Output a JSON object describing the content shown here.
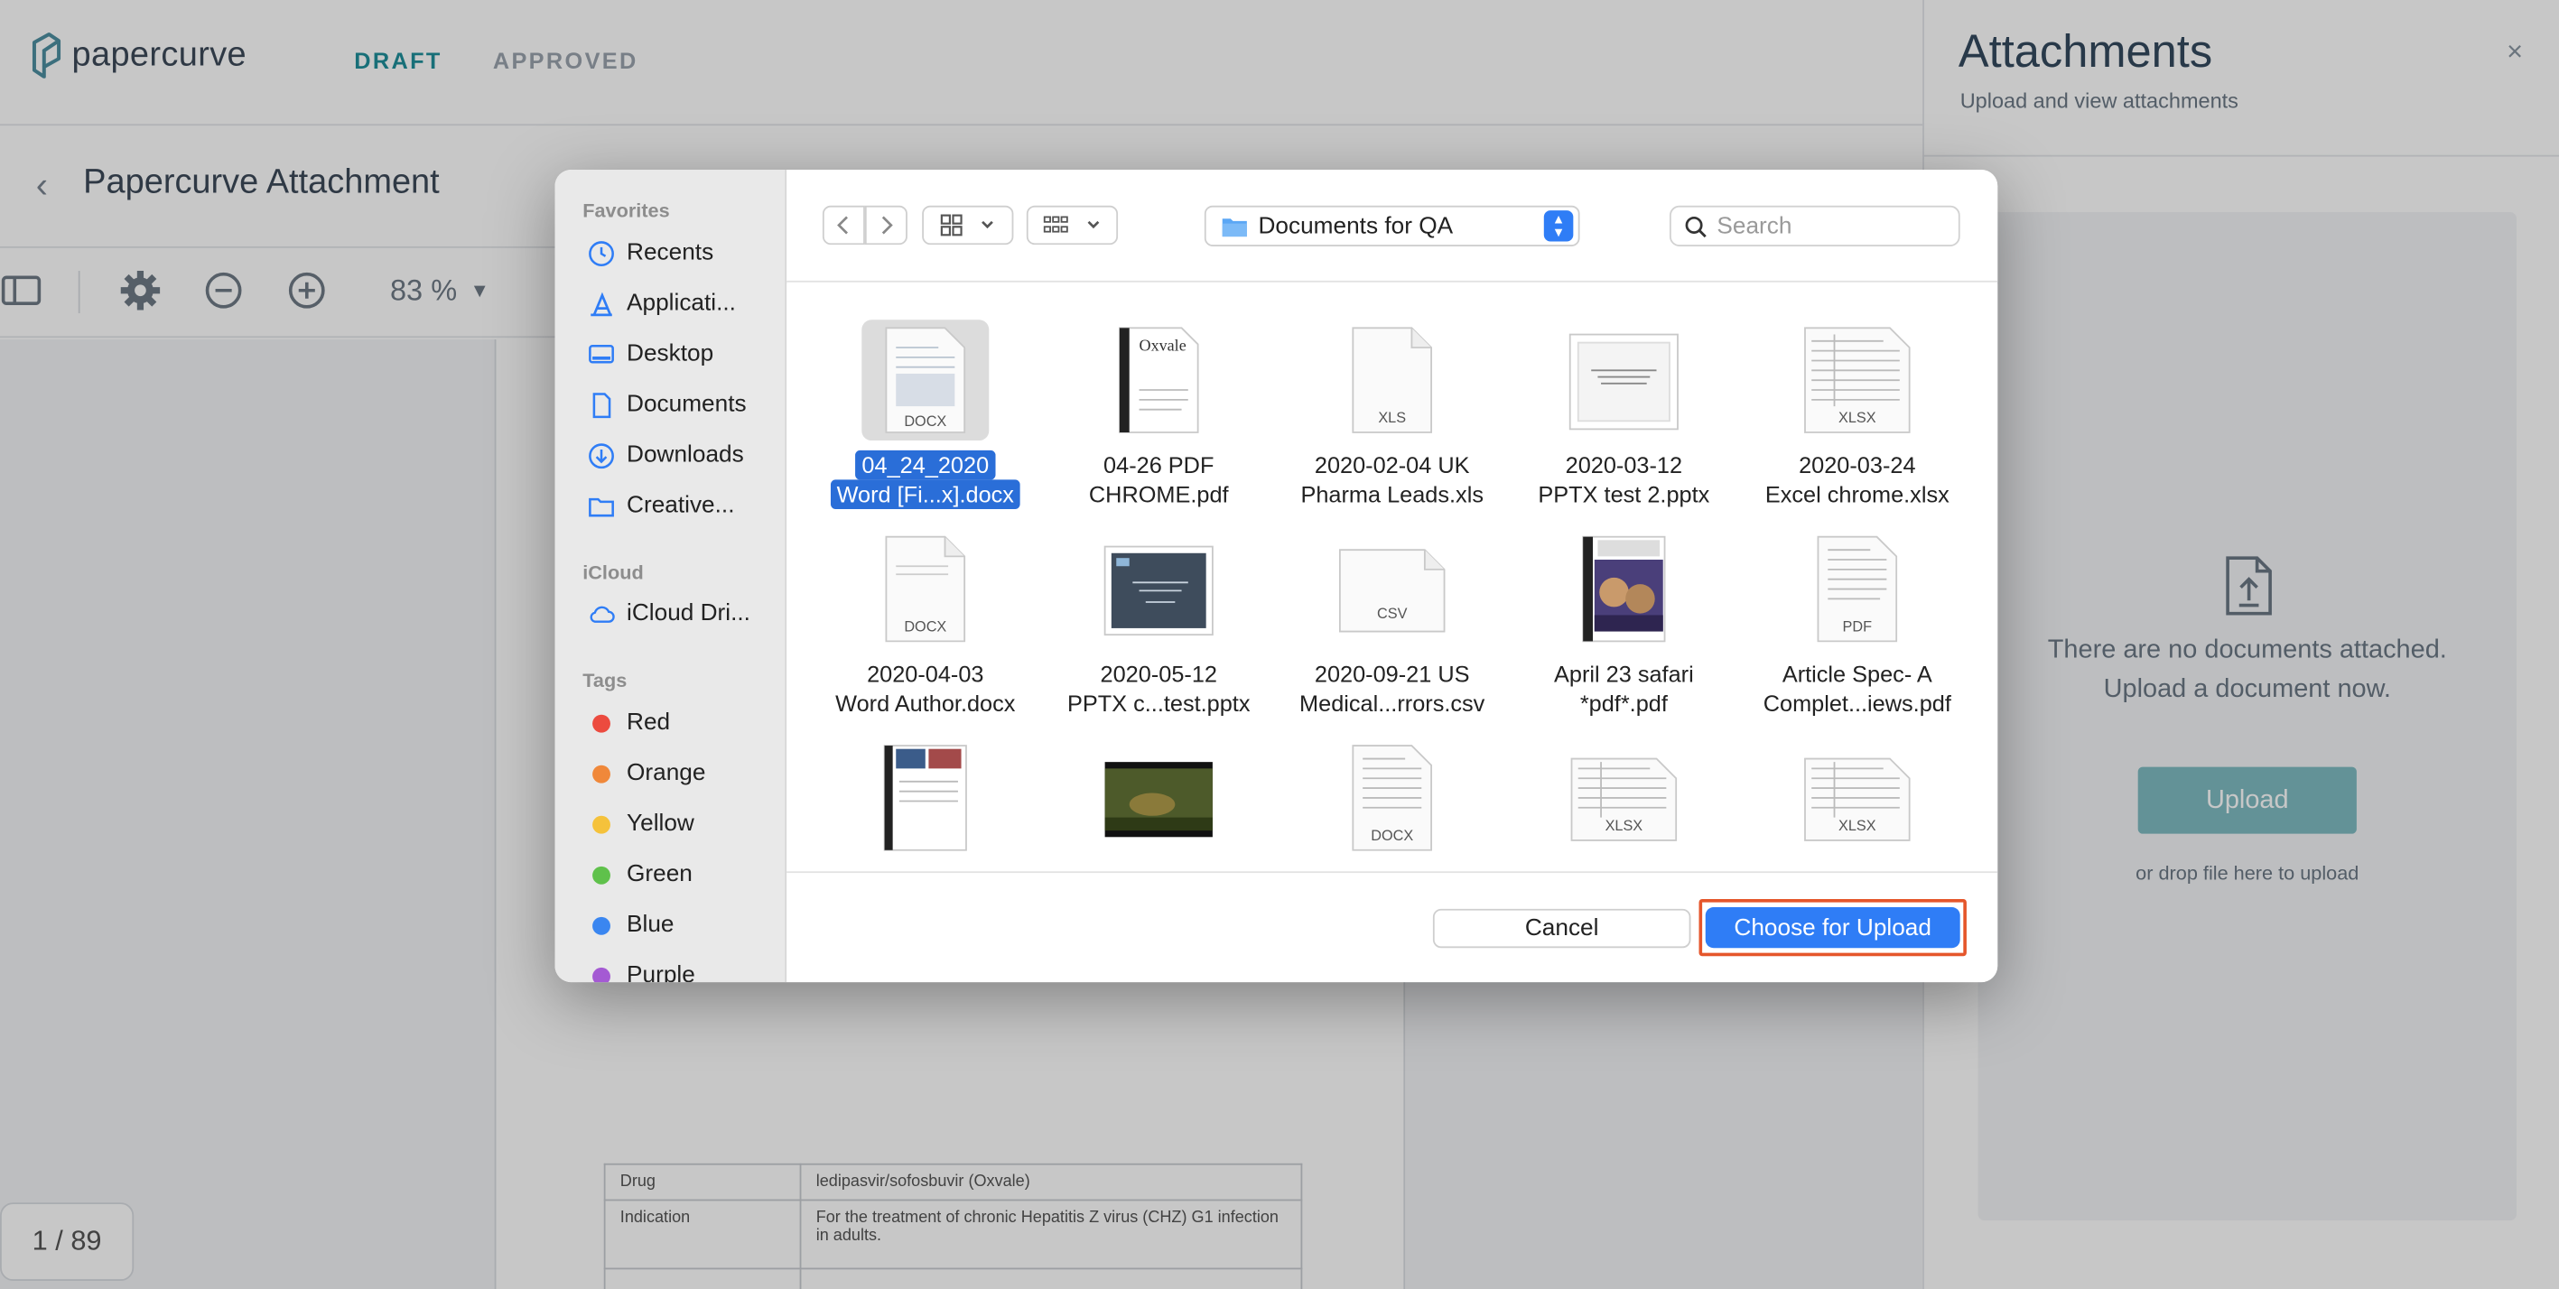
{
  "app": {
    "logo_text": "papercurve",
    "tabs": [
      "DRAFT",
      "APPROVED"
    ],
    "doc_title": "Papercurve Attachment",
    "zoom": "83 %",
    "page_counter": "1 / 89"
  },
  "document_table": [
    {
      "label": "Drug",
      "value": "ledipasvir/sofosbuvir (Oxvale)"
    },
    {
      "label": "Indication",
      "value": "For the treatment of chronic Hepatitis Z virus (CHZ) G1 infection in adults."
    }
  ],
  "attachments": {
    "title": "Attachments",
    "subtitle": "Upload and view attachments",
    "close": "×",
    "empty_line1": "There are no documents attached.",
    "empty_line2": "Upload a document now.",
    "upload_label": "Upload",
    "drop_hint": "or drop file here to upload"
  },
  "dialog": {
    "favorites_heading": "Favorites",
    "favorites": [
      {
        "label": "Recents",
        "icon": "clock-icon"
      },
      {
        "label": "Applicati...",
        "icon": "applications-icon"
      },
      {
        "label": "Desktop",
        "icon": "desktop-icon"
      },
      {
        "label": "Documents",
        "icon": "document-icon"
      },
      {
        "label": "Downloads",
        "icon": "download-icon"
      },
      {
        "label": "Creative...",
        "icon": "folder-icon"
      }
    ],
    "icloud_heading": "iCloud",
    "icloud_item": "iCloud Dri...",
    "tags_heading": "Tags",
    "tags": [
      {
        "label": "Red",
        "color": "#ec4b3f"
      },
      {
        "label": "Orange",
        "color": "#f0883a"
      },
      {
        "label": "Yellow",
        "color": "#f5c23b"
      },
      {
        "label": "Green",
        "color": "#5fc14b"
      },
      {
        "label": "Blue",
        "color": "#3a86f0"
      },
      {
        "label": "Purple",
        "color": "#a45ad3"
      }
    ],
    "path": "Documents for QA",
    "search_placeholder": "Search",
    "files": [
      {
        "line1": "04_24_2020",
        "line2": "Word [Fi...x].docx",
        "badge": "DOCX",
        "selected": true
      },
      {
        "line1": "04-26 PDF",
        "line2": "CHROME.pdf",
        "badge": "Oxvale"
      },
      {
        "line1": "2020-02-04 UK",
        "line2": "Pharma Leads.xls",
        "badge": "XLS"
      },
      {
        "line1": "2020-03-12",
        "line2": "PPTX test 2.pptx",
        "badge": ""
      },
      {
        "line1": "2020-03-24",
        "line2": "Excel chrome.xlsx",
        "badge": "XLSX"
      },
      {
        "line1": "2020-04-03",
        "line2": "Word Author.docx",
        "badge": "DOCX"
      },
      {
        "line1": "2020-05-12",
        "line2": "PPTX c...test.pptx",
        "badge": ""
      },
      {
        "line1": "2020-09-21 US",
        "line2": "Medical...rrors.csv",
        "badge": "CSV"
      },
      {
        "line1": "April 23 safari",
        "line2": "*pdf*.pdf",
        "badge": ""
      },
      {
        "line1": "Article Spec- A",
        "line2": "Complet...iews.pdf",
        "badge": "PDF"
      },
      {
        "line1": "",
        "line2": "",
        "badge": ""
      },
      {
        "line1": "",
        "line2": "",
        "badge": ""
      },
      {
        "line1": "",
        "line2": "",
        "badge": "DOCX"
      },
      {
        "line1": "",
        "line2": "",
        "badge": "XLSX"
      },
      {
        "line1": "",
        "line2": "",
        "badge": "XLSX"
      }
    ],
    "cancel_label": "Cancel",
    "choose_label": "Choose for Upload"
  },
  "colors": {
    "accent": "#2f7df6",
    "brand_teal": "#1f8f9a",
    "highlight_outline": "#e5562b"
  }
}
